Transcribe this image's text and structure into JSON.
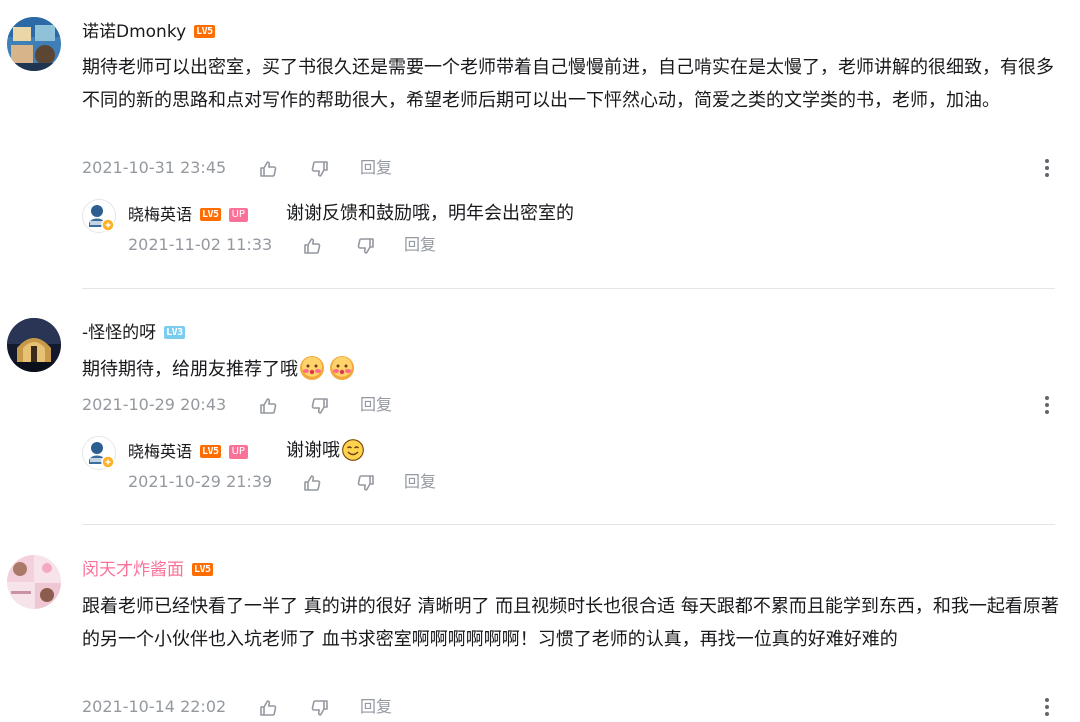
{
  "comments": [
    {
      "username": "诺诺Dmonky",
      "level": "LV5",
      "content": "期待老师可以出密室，买了书很久还是需要一个老师带着自己慢慢前进，自己啃实在是太慢了，老师讲解的很细致，有很多不同的新的思路和点对写作的帮助很大，希望老师后期可以出一下怦然心动，简爱之类的文学类的书，老师，加油。",
      "time": "2021-10-31 23:45",
      "reply_label": "回复",
      "reply": {
        "username": "晓梅英语",
        "level": "LV5",
        "badge": "UP",
        "text": "谢谢反馈和鼓励哦，明年会出密室的",
        "time": "2021-11-02 11:33",
        "reply_label": "回复"
      }
    },
    {
      "username": "-怪怪的呀",
      "level": "LV3",
      "content": "期待期待，给朋友推荐了哦",
      "time": "2021-10-29 20:43",
      "reply_label": "回复",
      "reply": {
        "username": "晓梅英语",
        "level": "LV5",
        "badge": "UP",
        "text": "谢谢哦",
        "time": "2021-10-29 21:39",
        "reply_label": "回复"
      }
    },
    {
      "username": "闵天才炸酱面",
      "level": "LV5",
      "content": "跟着老师已经快看了一半了 真的讲的很好 清晰明了 而且视频时长也很合适 每天跟都不累而且能学到东西，和我一起看原著的另一个小伙伴也入坑老师了 血书求密室啊啊啊啊啊啊！习惯了老师的认真，再找一位真的好难好难的",
      "time": "2021-10-14 22:02",
      "reply_label": "回复"
    }
  ],
  "colors": {
    "accent": "#fb7299",
    "lv5": "#ff6c00",
    "lv3": "#7bcdef",
    "meta": "#9499a0"
  },
  "icons": [
    "like-icon",
    "dislike-icon",
    "more-icon",
    "emoji-blush-icon",
    "emoji-smile-icon"
  ]
}
